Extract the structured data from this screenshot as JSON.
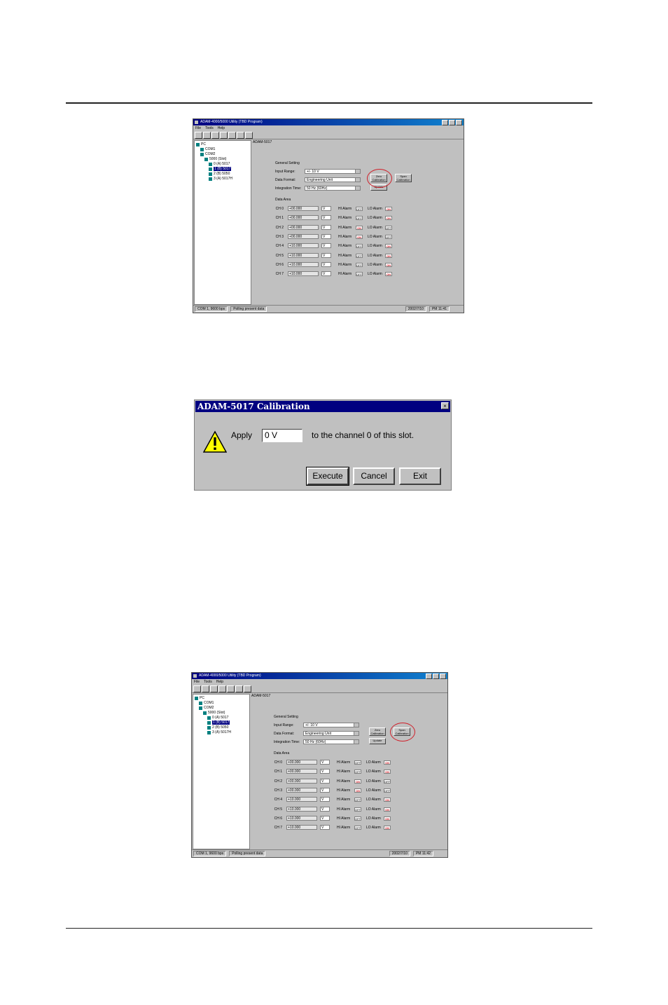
{
  "screenshot_top": {
    "title": "ADAM-4000/5000 Utility (TBD Program)",
    "menu": [
      "File",
      "Tools",
      "Help"
    ],
    "toolbar": [
      "",
      "",
      "",
      "",
      "",
      "",
      ""
    ],
    "tree": [
      "PC",
      "COM1",
      "COM2",
      "5000 (Slot)",
      "0 (A) 5017",
      "1 (B) 5017",
      "2 (B) 5050",
      "3 (A) 5017H"
    ],
    "module_label": "ADAM-5017",
    "general_setting": "General Setting",
    "input_range_label": "Input Range:",
    "input_range_value": "+/- 10 V",
    "data_format_label": "Data Format:",
    "data_format_value": "Engineering Unit",
    "integration_label": "Integration Time:",
    "integration_value": "50 Hz (60Hz)",
    "zero_btn": "Zero Calibration",
    "span_btn": "Span Calibration",
    "update_btn": "Update",
    "data_area": "Data Area",
    "status": [
      "COM 1, 9600 bps",
      "Polling present data",
      "2002/7/10",
      "PM 11:41"
    ],
    "channels": [
      {
        "ch": "CH 0",
        "val": "+00.000",
        "unit": "V",
        "hi": "HI Alarm",
        "hs": "OFF",
        "lo": "LO Alarm",
        "ls": "ON"
      },
      {
        "ch": "CH 1",
        "val": "+00.000",
        "unit": "V",
        "hi": "HI Alarm",
        "hs": "OFF",
        "lo": "LO Alarm",
        "ls": "ON"
      },
      {
        "ch": "CH 2",
        "val": "+00.000",
        "unit": "V",
        "hi": "HI Alarm",
        "hs": "ON",
        "lo": "LO Alarm",
        "ls": "OFF"
      },
      {
        "ch": "CH 3",
        "val": "+00.000",
        "unit": "V",
        "hi": "HI Alarm",
        "hs": "ON",
        "lo": "LO Alarm",
        "ls": "OFF"
      },
      {
        "ch": "CH 4",
        "val": "+10.000",
        "unit": "V",
        "hi": "HI Alarm",
        "hs": "OFF",
        "lo": "LO Alarm",
        "ls": "ON"
      },
      {
        "ch": "CH 5",
        "val": "+10.000",
        "unit": "V",
        "hi": "HI Alarm",
        "hs": "OFF",
        "lo": "LO Alarm",
        "ls": "ON"
      },
      {
        "ch": "CH 6",
        "val": "+10.000",
        "unit": "V",
        "hi": "HI Alarm",
        "hs": "OFF",
        "lo": "LO Alarm",
        "ls": "ON"
      },
      {
        "ch": "CH 7",
        "val": "+10.000",
        "unit": "V",
        "hi": "HI Alarm",
        "hs": "OFF",
        "lo": "LO Alarm",
        "ls": "ON"
      }
    ]
  },
  "dialog": {
    "title": "ADAM-5017 Calibration",
    "close": "×",
    "apply_label": "Apply",
    "value": "0 V",
    "suffix": "to the channel 0 of this slot.",
    "execute": "Execute",
    "cancel": "Cancel",
    "exit": "Exit"
  },
  "screenshot_bottom": {
    "title": "ADAM-4000/5000 Utility (TBD Program)",
    "menu": [
      "File",
      "Tools",
      "Help"
    ],
    "toolbar": [
      "",
      "",
      "",
      "",
      "",
      "",
      ""
    ],
    "tree": [
      "PC",
      "COM1",
      "COM2",
      "5000 (Slot)",
      "0 (A) 5017",
      "1 (B) 5017",
      "2 (B) 5050",
      "3 (A) 5017H"
    ],
    "module_label": "ADAM-5017",
    "general_setting": "General Setting",
    "input_range_label": "Input Range:",
    "input_range_value": "+/- 10 V",
    "data_format_label": "Data Format:",
    "data_format_value": "Engineering Unit",
    "integration_label": "Integration Time:",
    "integration_value": "50 Hz (60Hz)",
    "zero_btn": "Zero Calibration",
    "span_btn": "Span Calibration",
    "update_btn": "Update",
    "data_area": "Data Area",
    "status": [
      "COM 1, 9600 bps",
      "Polling present data",
      "2002/7/10",
      "PM 11:42"
    ],
    "channels": [
      {
        "ch": "CH 0",
        "val": "+00.000",
        "unit": "V",
        "hi": "HI Alarm",
        "hs": "OFF",
        "lo": "LO Alarm",
        "ls": "ON"
      },
      {
        "ch": "CH 1",
        "val": "+00.000",
        "unit": "V",
        "hi": "HI Alarm",
        "hs": "OFF",
        "lo": "LO Alarm",
        "ls": "ON"
      },
      {
        "ch": "CH 2",
        "val": "+00.000",
        "unit": "V",
        "hi": "HI Alarm",
        "hs": "ON",
        "lo": "LO Alarm",
        "ls": "OFF"
      },
      {
        "ch": "CH 3",
        "val": "+00.000",
        "unit": "V",
        "hi": "HI Alarm",
        "hs": "ON",
        "lo": "LO Alarm",
        "ls": "OFF"
      },
      {
        "ch": "CH 4",
        "val": "+10.000",
        "unit": "V",
        "hi": "HI Alarm",
        "hs": "OFF",
        "lo": "LO Alarm",
        "ls": "ON"
      },
      {
        "ch": "CH 5",
        "val": "+10.000",
        "unit": "V",
        "hi": "HI Alarm",
        "hs": "OFF",
        "lo": "LO Alarm",
        "ls": "ON"
      },
      {
        "ch": "CH 6",
        "val": "+10.000",
        "unit": "V",
        "hi": "HI Alarm",
        "hs": "OFF",
        "lo": "LO Alarm",
        "ls": "ON"
      },
      {
        "ch": "CH 7",
        "val": "+10.000",
        "unit": "V",
        "hi": "HI Alarm",
        "hs": "OFF",
        "lo": "LO Alarm",
        "ls": "ON"
      }
    ]
  }
}
